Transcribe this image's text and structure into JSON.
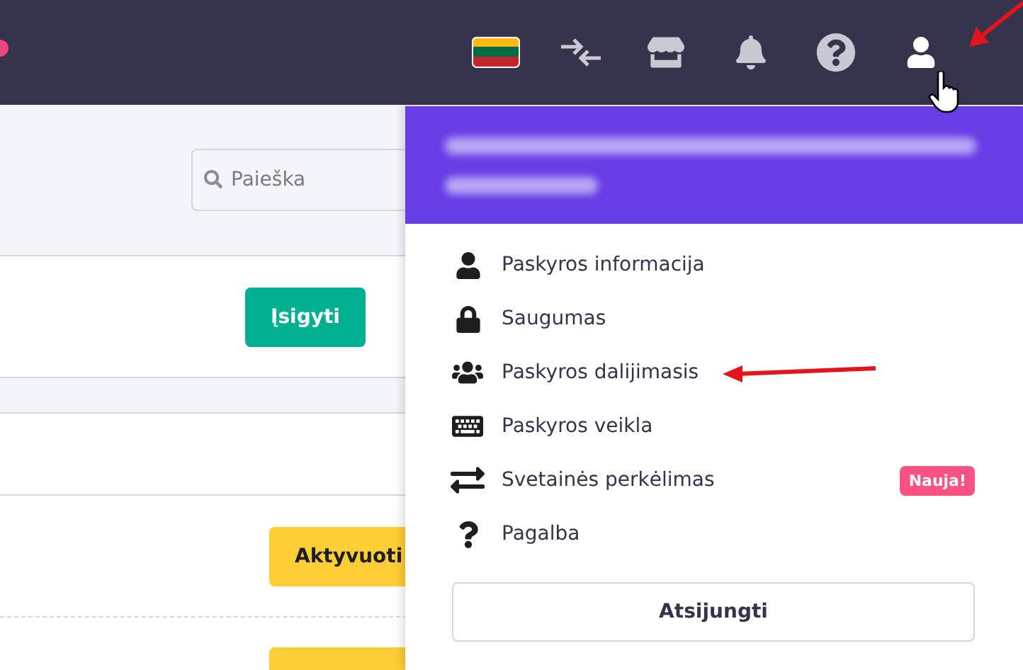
{
  "search": {
    "placeholder": "Paieška"
  },
  "buy_button": "Įsigyti",
  "activate_buttons": [
    "Aktyvuoti"
  ],
  "account_menu": {
    "items": [
      {
        "label": "Paskyros informacija"
      },
      {
        "label": "Saugumas"
      },
      {
        "label": "Paskyros dalijimasis"
      },
      {
        "label": "Paskyros veikla"
      },
      {
        "label": "Svetainės perkėlimas",
        "badge": "Nauja!"
      },
      {
        "label": "Pagalba"
      }
    ],
    "logout": "Atsijungti"
  }
}
